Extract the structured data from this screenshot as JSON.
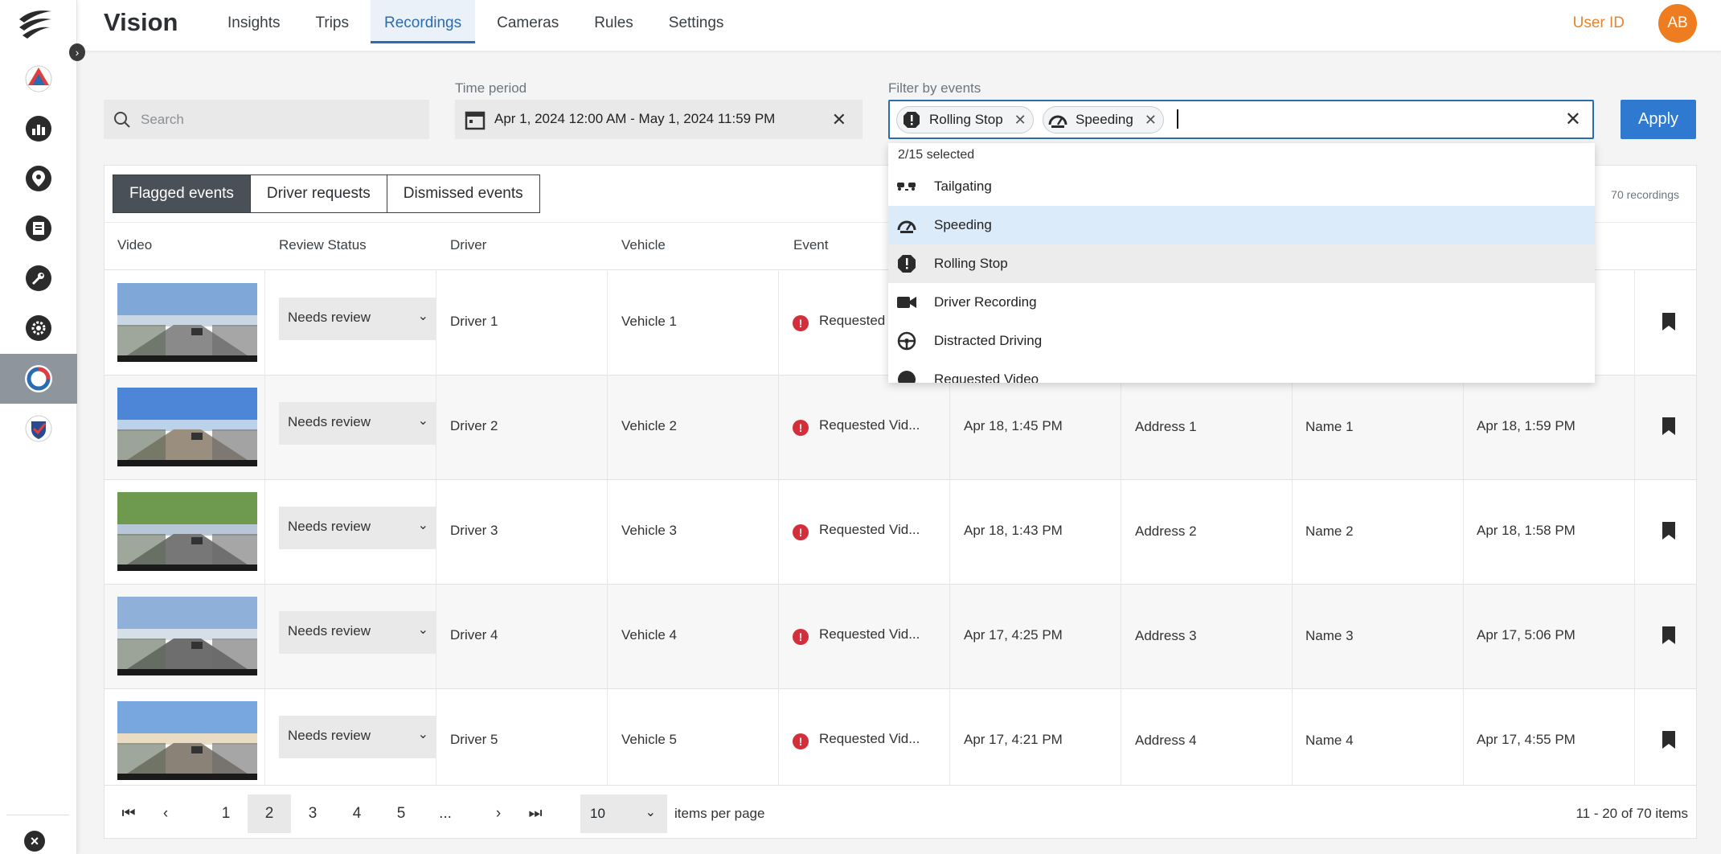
{
  "app": {
    "title": "Vision"
  },
  "nav": {
    "tabs": [
      "Insights",
      "Trips",
      "Recordings",
      "Cameras",
      "Rules",
      "Settings"
    ],
    "active": "Recordings"
  },
  "user": {
    "id_label": "User ID",
    "initials": "AB"
  },
  "filters": {
    "search_placeholder": "Search",
    "time_period_label": "Time period",
    "time_period_value": "Apr 1, 2024 12:00 AM - May 1, 2024 11:59 PM",
    "events_label": "Filter by events",
    "selected_chips": [
      "Rolling Stop",
      "Speeding"
    ],
    "apply_label": "Apply"
  },
  "dropdown": {
    "selected_count": "2/15 selected",
    "options": [
      "Tailgating",
      "Speeding",
      "Rolling Stop",
      "Driver Recording",
      "Distracted Driving",
      "Requested Video"
    ]
  },
  "segments": [
    "Flagged events",
    "Driver requests",
    "Dismissed events"
  ],
  "recordings_count": "70 recordings",
  "table": {
    "columns": [
      "Video",
      "Review Status",
      "Driver",
      "Vehicle",
      "Event"
    ],
    "rows": [
      {
        "status": "Needs review",
        "driver": "Driver 1",
        "vehicle": "Vehicle 1",
        "event": "Requested",
        "time": "",
        "address": "",
        "name": "",
        "end": ""
      },
      {
        "status": "Needs review",
        "driver": "Driver 2",
        "vehicle": "Vehicle 2",
        "event": "Requested Vid...",
        "time": "Apr 18, 1:45 PM",
        "address": "Address 1",
        "name": "Name 1",
        "end": "Apr 18, 1:59 PM"
      },
      {
        "status": "Needs review",
        "driver": "Driver 3",
        "vehicle": "Vehicle 3",
        "event": "Requested Vid...",
        "time": "Apr 18, 1:43 PM",
        "address": "Address 2",
        "name": "Name 2",
        "end": "Apr 18, 1:58 PM"
      },
      {
        "status": "Needs review",
        "driver": "Driver 4",
        "vehicle": "Vehicle 4",
        "event": "Requested Vid...",
        "time": "Apr 17, 4:25 PM",
        "address": "Address 3",
        "name": "Name 3",
        "end": "Apr 17, 5:06 PM"
      },
      {
        "status": "Needs review",
        "driver": "Driver 5",
        "vehicle": "Vehicle 5",
        "event": "Requested Vid...",
        "time": "Apr 17, 4:21 PM",
        "address": "Address 4",
        "name": "Name 4",
        "end": "Apr 17, 4:55 PM"
      }
    ]
  },
  "pagination": {
    "pages": [
      "1",
      "2",
      "3",
      "4",
      "5",
      "..."
    ],
    "current": "2",
    "per_page": "10",
    "per_page_label": "items per page",
    "summary": "11 - 20 of 70 items"
  },
  "colors": {
    "accent": "#2f7ad0",
    "avatar": "#ee7d22",
    "event_alert": "#d32f3a"
  }
}
